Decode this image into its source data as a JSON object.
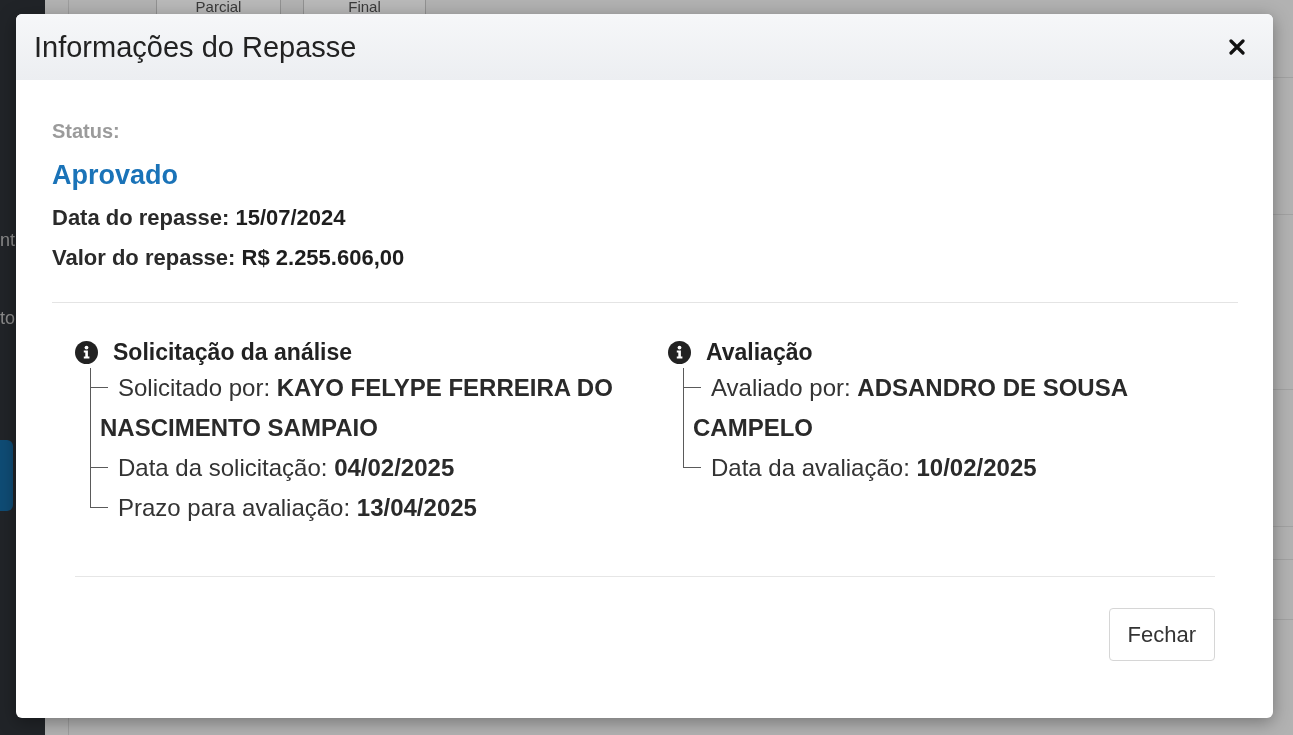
{
  "background": {
    "tabs": [
      {
        "label": "Parcial"
      },
      {
        "label": "Final"
      }
    ],
    "sidebar": {
      "items": [
        {
          "label": "nt"
        },
        {
          "label": "to"
        }
      ]
    }
  },
  "modal": {
    "title": "Informações do Repasse",
    "status": {
      "label": "Status:",
      "value": "Aprovado"
    },
    "details": [
      {
        "label": "Data do repasse:",
        "value": "15/07/2024"
      },
      {
        "label": "Valor do repasse:",
        "value": "R$ 2.255.606,00"
      }
    ],
    "sections": [
      {
        "title": "Solicitação da análise",
        "items": [
          {
            "label": "Solicitado por:",
            "value": "KAYO FELYPE FERREIRA DO NASCIMENTO SAMPAIO"
          },
          {
            "label": "Data da solicitação:",
            "value": "04/02/2025"
          },
          {
            "label": "Prazo para avaliação:",
            "value": "13/04/2025"
          }
        ]
      },
      {
        "title": "Avaliação",
        "items": [
          {
            "label": "Avaliado por:",
            "value": "ADSANDRO DE SOUSA CAMPELO"
          },
          {
            "label": "Data da avaliação:",
            "value": "10/02/2025"
          }
        ]
      }
    ],
    "buttons": [
      {
        "label": "Fechar"
      }
    ]
  }
}
